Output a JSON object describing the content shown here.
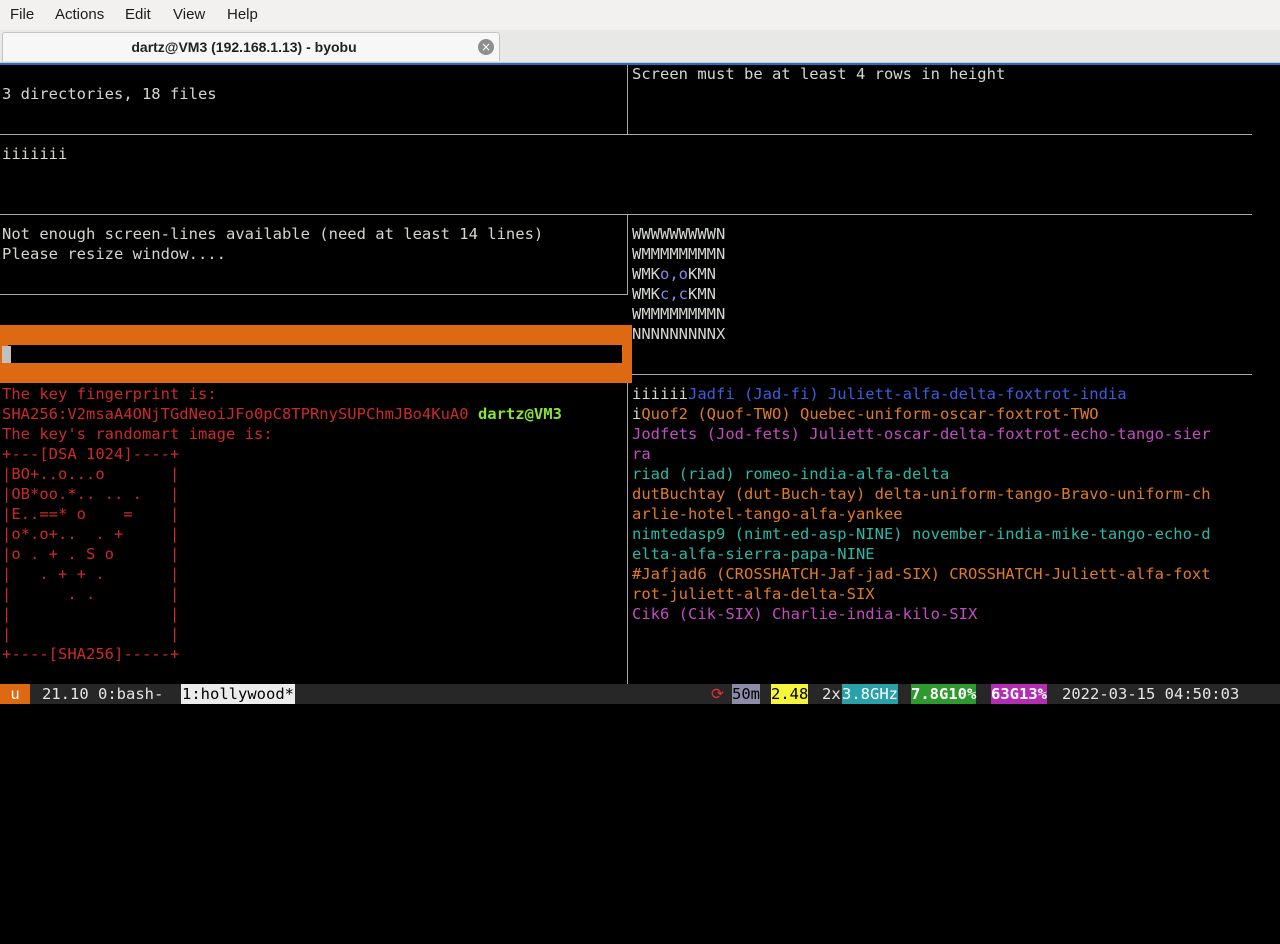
{
  "menu": {
    "file": "File",
    "actions": "Actions",
    "edit": "Edit",
    "view": "View",
    "help": "Help"
  },
  "tab": {
    "title": "dartz@VM3 (192.168.1.13) - byobu",
    "close": "×"
  },
  "terminal": {
    "pane1": {
      "line1": "3 directories, 18 files"
    },
    "pane2": {
      "line1": "Screen must be at least 4 rows in height"
    },
    "pane3": {
      "line1": "iiiiiii"
    },
    "pane4": {
      "line1": "Not enough screen-lines available (need at least 14 lines)",
      "line2": "Please resize window...."
    },
    "pane5": {
      "lines": [
        "WWWWWWWWWN",
        "WMMMMMMMMN",
        "WMK",
        "o,o",
        "KMN",
        "WMK",
        "c,c",
        "KMN",
        "WMMMMMMMMN",
        "NNNNNNNNNX"
      ]
    },
    "pane6": {
      "fp_label": "The key fingerprint is:",
      "fp_value": "SHA256:V2msaA4ONjTGdNeoiJFo0pC8TPRnySUPChmJBo4KuA0",
      "fp_user": "dartz@VM3",
      "randomart_label": "The key's randomart image is:",
      "art": [
        "+---[DSA 1024]----+",
        "|BO+..o...o       |",
        "|OB*oo.*.. .. .   |",
        "|E..==* o    =    |",
        "|o*.o+..  . +     |",
        "|o . + . S o      |",
        "|   . + + .       |",
        "|      . .        |",
        "|                 |",
        "|                 |",
        "+----[SHA256]-----+"
      ]
    },
    "pane7": {
      "l1a": "iiiiii",
      "l1b": "Jadfi (Jad-fi) Juliett-alfa-delta-foxtrot-india",
      "l2a": "i",
      "l2b": "Quof2 (Quof-TWO) Quebec-uniform-oscar-foxtrot-TWO",
      "l3": "Jodfets (Jod-fets) Juliett-oscar-delta-foxtrot-echo-tango-sier",
      "l4": "ra",
      "l5": "riad (riad) romeo-india-alfa-delta",
      "l6": "dutBuchtay (dut-Buch-tay) delta-uniform-tango-Bravo-uniform-ch",
      "l7": "arlie-hotel-tango-alfa-yankee",
      "l8": "nimtedasp9 (nimt-ed-asp-NINE) november-india-mike-tango-echo-d",
      "l9": "elta-alfa-sierra-papa-NINE",
      "l10": "#Jafjad6 (CROSSHATCH-Jaf-jad-SIX) CROSSHATCH-Juliett-alfa-foxt",
      "l11": "rot-juliett-alfa-delta-SIX",
      "l12": "Cik6 (Cik-SIX) Charlie-india-kilo-SIX"
    }
  },
  "status": {
    "u": "u",
    "version": "21.10",
    "win0": "0:bash-",
    "win1": "1:hollywood*",
    "restart": "⟳",
    "uptime": "50m",
    "load": "2.48",
    "cpus": "2x",
    "freq": "3.8GHz",
    "disk_pct": "7.8G",
    "disk_used": "10%",
    "mem": "63G",
    "mem_pct": "13%",
    "datetime": "2022-03-15 04:50:03"
  },
  "colors": {
    "accent_orange": "#dd6a12",
    "status_bg": "#272727",
    "window_border": "#2a6fbf"
  }
}
